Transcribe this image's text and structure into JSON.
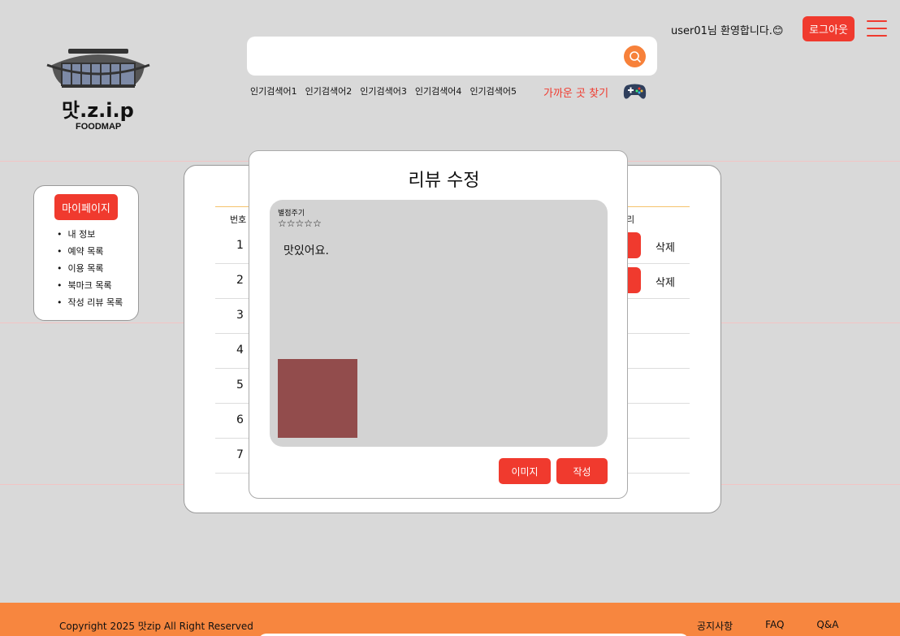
{
  "header": {
    "logo_text": "맛.z.i.p",
    "logo_sub": "FOODMAP",
    "search_placeholder": "",
    "popular_searches": [
      "인기검색어1",
      "인기검색어2",
      "인기검색어3",
      "인기검색어4",
      "인기검색어5"
    ],
    "nearby_label": "가까운 곳 찾기",
    "welcome": "user01님 환영합니다.😊",
    "logout_label": "로그아웃"
  },
  "sidebar": {
    "title": "마이페이지",
    "items": [
      "내 정보",
      "예약 목록",
      "이용 목록",
      "북마크 목록",
      "작성 리뷰 목록"
    ]
  },
  "table": {
    "header_num": "번호",
    "header_right": "리",
    "rows": [
      {
        "num": "1",
        "delete": "삭제"
      },
      {
        "num": "2",
        "delete": "삭제"
      },
      {
        "num": "3",
        "delete": ""
      },
      {
        "num": "4",
        "delete": ""
      },
      {
        "num": "5",
        "delete": ""
      },
      {
        "num": "6",
        "delete": ""
      },
      {
        "num": "7",
        "delete": ""
      }
    ]
  },
  "modal": {
    "title": "리뷰 수정",
    "rating_label": "별점주기",
    "stars": [
      "☆",
      "☆",
      "☆",
      "☆",
      "☆"
    ],
    "review_text": "맛있어요.",
    "image_button": "이미지",
    "write_button": "작성"
  },
  "footer": {
    "copyright": "Copyright 2025 맛zip All Right Reserved",
    "links": [
      "공지사항",
      "FAQ",
      "Q&A"
    ]
  },
  "colors": {
    "accent": "#f03a2e",
    "footer": "#f7863f",
    "background": "#d9d9d9",
    "image_placeholder": "#924c4c"
  },
  "icons": {
    "search": "search-icon",
    "game": "gamepad-icon",
    "menu": "hamburger-menu-icon"
  }
}
